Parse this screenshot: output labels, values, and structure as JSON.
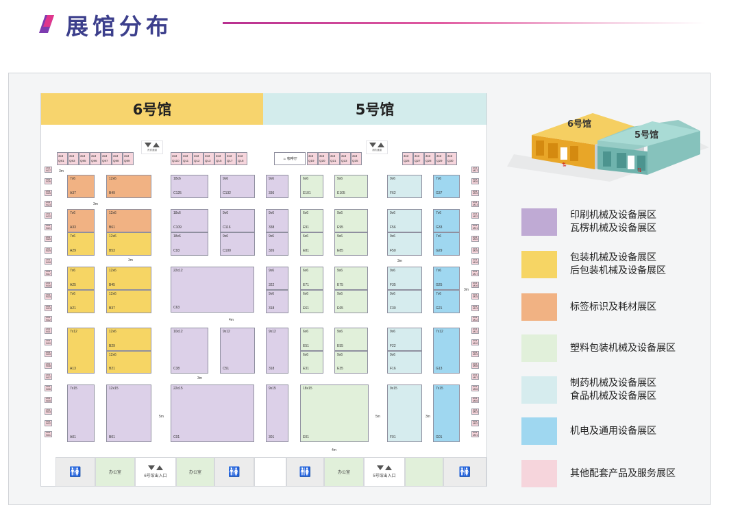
{
  "title": "展馆分布",
  "colors": {
    "印刷": "#dcd0e8",
    "包装": "#f6d564",
    "标签": "#f1b283",
    "塑料": "#e1f0da",
    "制药": "#d6ecee",
    "机电": "#9fd7f0",
    "其他": "#f6d5dc"
  },
  "halls": {
    "h6": "6号馆",
    "h5": "5号馆"
  },
  "top_row": [
    [
      "3x3",
      "Q81"
    ],
    [
      "3x3",
      "Q83"
    ],
    [
      "3x3",
      "Q85"
    ],
    [
      "3x3",
      "Q86"
    ],
    [
      "3x3",
      "Q87"
    ],
    [
      "3x3",
      "Q88"
    ],
    [
      "3x3",
      "Q89"
    ],
    [
      "3x3",
      "Q110"
    ],
    [
      "3x3",
      "Q11"
    ],
    [
      "3x3",
      "Q12"
    ],
    [
      "3x3",
      "Q13"
    ],
    [
      "3x3",
      "Q15"
    ],
    [
      "3x3",
      "Q17"
    ],
    [
      "3x3",
      "Q18"
    ],
    [
      "3x3",
      "Q19"
    ],
    [
      "3x3",
      "Q20"
    ],
    [
      "3x3",
      "Q21"
    ],
    [
      "3x3",
      "Q23"
    ],
    [
      "3x3",
      "Q25"
    ],
    [
      "3x3",
      "Q26"
    ],
    [
      "3x3",
      "Q27"
    ],
    [
      "3x3",
      "Q28"
    ],
    [
      "3x3",
      "Q29"
    ],
    [
      "3x3",
      "Q30"
    ]
  ],
  "top_misc": {
    "gate_l": "贵宾通道",
    "gate_r": "消防通道",
    "cafe": "咖啡厅"
  },
  "left_col": [
    "3x3 N27",
    "3x3 N26",
    "3x3 N25",
    "3x3 N23",
    "3x3 N22",
    "3x3 N21",
    "3x3 N20",
    "3x3 N19",
    "3x3 N18",
    "3x3 N17",
    "3x3 N16",
    "3x3 N15",
    "3x3 N13",
    "3x3 N12",
    "3x3 N11",
    "3x3 N10",
    "3x3 N09",
    "3x3 N08",
    "3x3 N07",
    "3x3 N06",
    "3x3 N05",
    "3x3 N03",
    "3x3 N02",
    "3x3 N01"
  ],
  "right_col": [
    "3x3 M27",
    "3x3 M26",
    "3x3 M25",
    "3x3 M23",
    "3x3 M22",
    "3x3 M21",
    "3x3 M20",
    "3x3 M19",
    "3x3 M18",
    "3x3 M17",
    "3x3 M16",
    "3x3 M15",
    "3x3 M13",
    "3x3 M12",
    "3x3 M11",
    "3x3 M10",
    "3x3 M09",
    "3x3 M08",
    "3x3 M07",
    "3x3 M06",
    "3x3 M05",
    "3x3 M03",
    "3x3 M02",
    "3x3 M01"
  ],
  "booths": [
    [
      "7x6",
      "A37"
    ],
    [
      "12x6",
      "B49"
    ],
    [
      "18x6",
      "C125"
    ],
    [
      "9x6",
      "C132"
    ],
    [
      "9x6",
      "336"
    ],
    [
      "6x6",
      "E101"
    ],
    [
      "9x6",
      "E105"
    ],
    [
      "9x6",
      "F62"
    ],
    [
      "7x6",
      "G37"
    ],
    [
      "7x6",
      "A33"
    ],
    [
      "12x6",
      "B61"
    ],
    [
      "18x6",
      "C109"
    ],
    [
      "9x6",
      "C116"
    ],
    [
      "9x6",
      "338"
    ],
    [
      "6x6",
      "E91"
    ],
    [
      "9x6",
      "E95"
    ],
    [
      "9x6",
      "F56"
    ],
    [
      "7x6",
      "G33"
    ],
    [
      "7x6",
      "A29"
    ],
    [
      "12x6",
      "B53"
    ],
    [
      "18x6",
      "C93"
    ],
    [
      "9x6",
      "C100"
    ],
    [
      "9x6",
      "326"
    ],
    [
      "6x6",
      "E81"
    ],
    [
      "9x6",
      "E85"
    ],
    [
      "9x6",
      "F50"
    ],
    [
      "7x6",
      "G29"
    ],
    [
      "7x6",
      "A25"
    ],
    [
      "12x6",
      "B45"
    ],
    [
      "22x12",
      "C63"
    ],
    [
      "9x6",
      "322"
    ],
    [
      "6x6",
      "E71"
    ],
    [
      "9x6",
      "E75"
    ],
    [
      "9x6",
      "F35"
    ],
    [
      "7x6",
      "G25"
    ],
    [
      "7x6",
      "A21"
    ],
    [
      "12x6",
      "B37"
    ],
    [
      "9x6",
      "318"
    ],
    [
      "6x6",
      "E61"
    ],
    [
      "9x6",
      "E65"
    ],
    [
      "9x6",
      "F30"
    ],
    [
      "7x6",
      "G21"
    ],
    [
      "7x12",
      "A13"
    ],
    [
      "12x6",
      "B29"
    ],
    [
      "10x12",
      "C38"
    ],
    [
      "9x12",
      "C51"
    ],
    [
      "9x12",
      "318"
    ],
    [
      "6x6",
      "E51"
    ],
    [
      "9x6",
      "E55"
    ],
    [
      "9x6",
      "F22"
    ],
    [
      "7x12",
      "G13"
    ],
    [
      "12x6",
      "B21"
    ],
    [
      "6x6",
      "E31"
    ],
    [
      "9x6",
      "E35"
    ],
    [
      "9x6",
      "F16"
    ],
    [
      "7x15",
      "A01"
    ],
    [
      "12x15",
      "B01"
    ],
    [
      "22x15",
      "C01"
    ],
    [
      "9x15",
      "301"
    ],
    [
      "18x15",
      "E01"
    ],
    [
      "9x15",
      "F01"
    ],
    [
      "7x15",
      "G01"
    ]
  ],
  "aisles": [
    "3m",
    "3m",
    "3m",
    "3m",
    "4m",
    "3m",
    "5m",
    "5m",
    "3m",
    "3m",
    "4m"
  ],
  "facilities": {
    "office": "办公室",
    "exit6": "6号馆出入口",
    "exit5": "5号馆出入口"
  },
  "legend": [
    {
      "lines": [
        "印刷机械及设备展区",
        "瓦楞机械及设备展区"
      ],
      "color": "#bfaad4"
    },
    {
      "lines": [
        "包装机械及设备展区",
        "后包装机械及设备展区"
      ],
      "color": "#f6d564"
    },
    {
      "lines": [
        "标签标识及耗材展区"
      ],
      "color": "#f1b283"
    },
    {
      "lines": [
        "塑料包装机械及设备展区"
      ],
      "color": "#e1f0da"
    },
    {
      "lines": [
        "制药机械及设备展区",
        "食品机械及设备展区"
      ],
      "color": "#d6ecee"
    },
    {
      "lines": [
        "机电及通用设备展区"
      ],
      "color": "#9fd7f0"
    },
    {
      "lines": [
        "其他配套产品及服务展区"
      ],
      "color": "#f6d5dc"
    }
  ],
  "iso": {
    "h6": "6号馆",
    "h5": "5号馆"
  }
}
